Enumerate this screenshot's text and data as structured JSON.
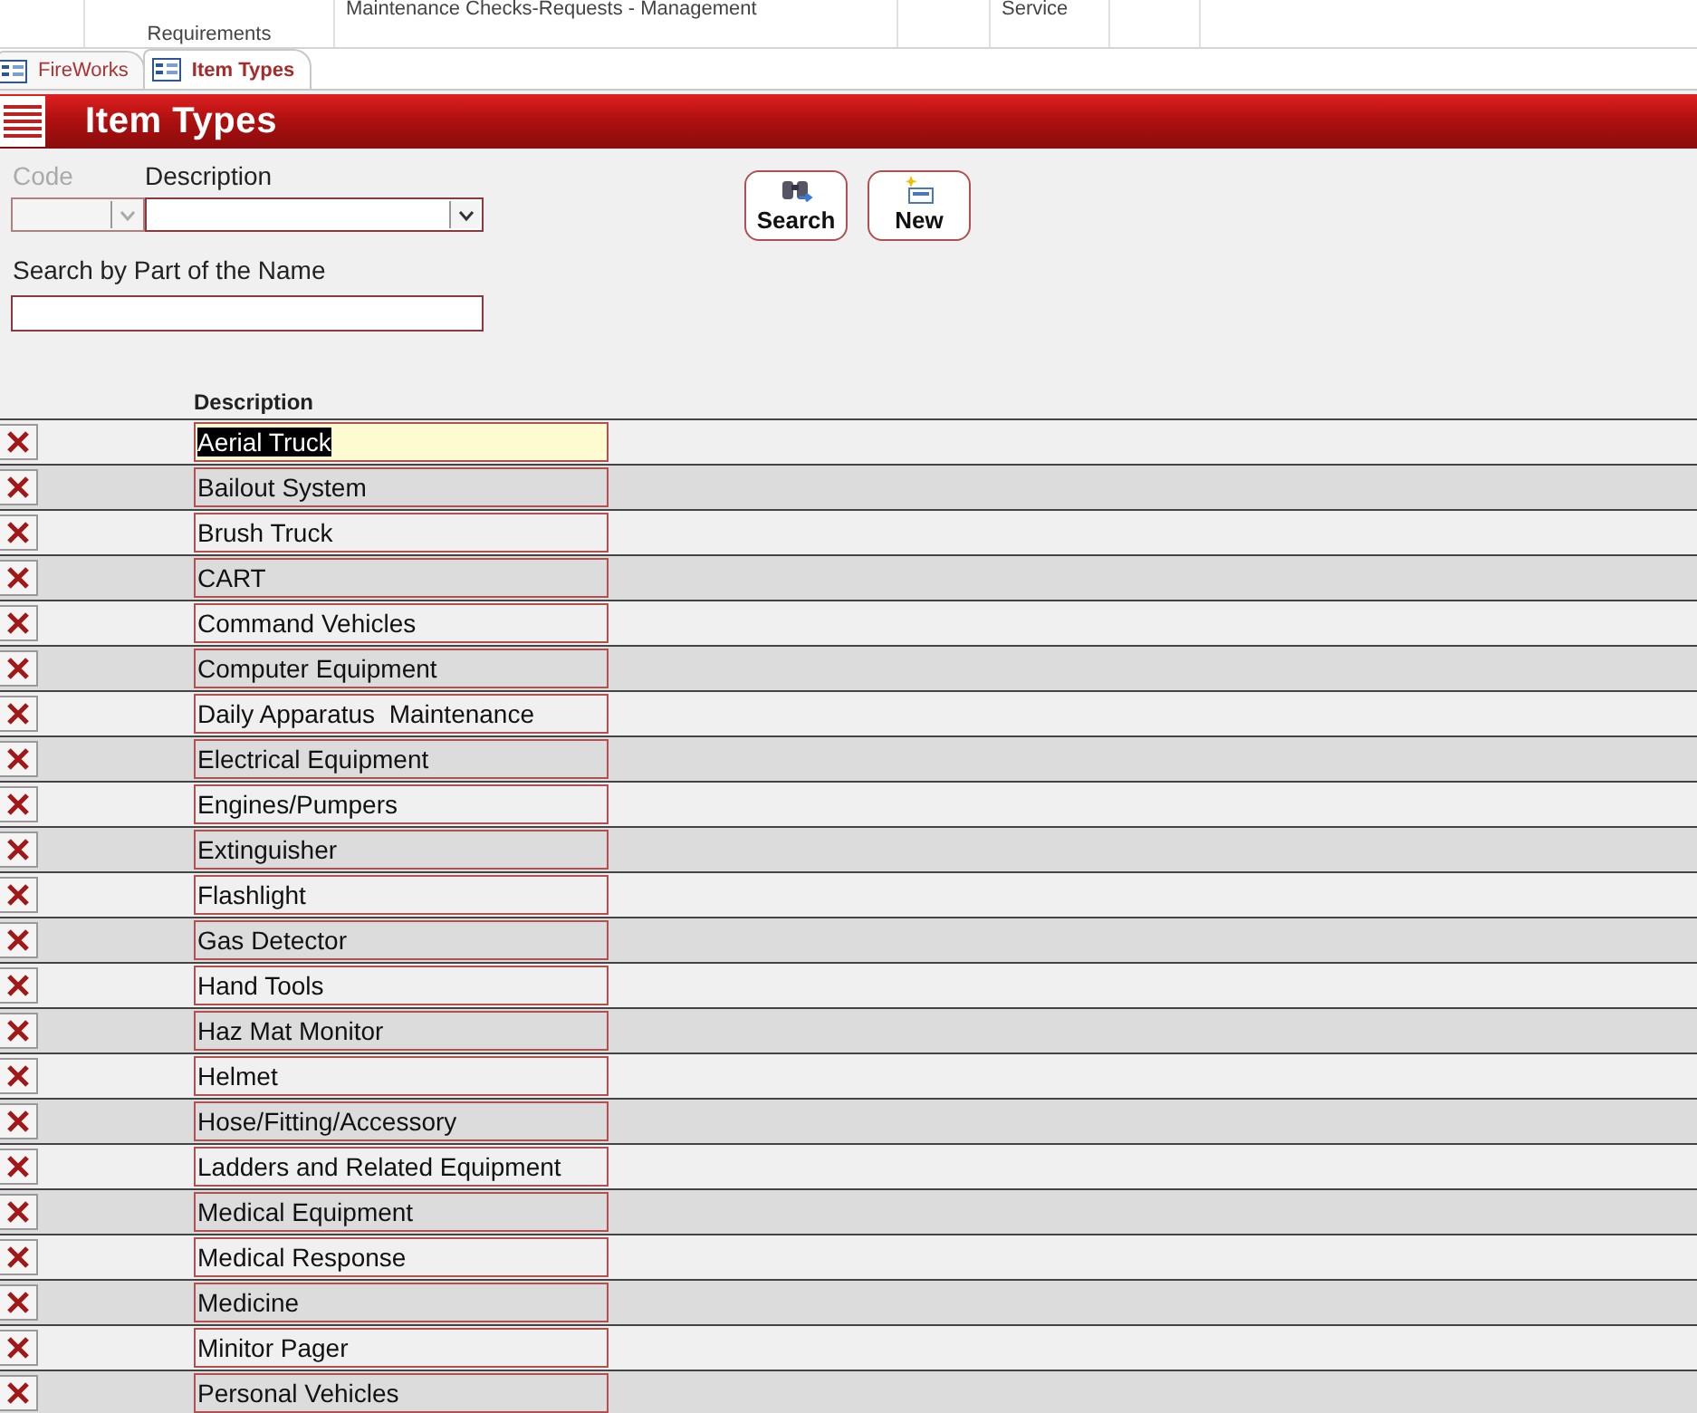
{
  "ribbon": {
    "items": [
      {
        "label": "Requirements",
        "kind": "caption"
      },
      {
        "label": "Maintenance Checks-Requests - Management",
        "kind": "command"
      },
      {
        "label": "Service",
        "kind": "command"
      }
    ]
  },
  "tabs": [
    {
      "label": "FireWorks",
      "selected": false
    },
    {
      "label": "Item Types",
      "selected": true
    }
  ],
  "header": {
    "title": "Item Types"
  },
  "filters": {
    "code": {
      "label": "Code",
      "disabled": true
    },
    "description": {
      "label": "Description"
    },
    "search_name": {
      "label": "Search by Part of the Name"
    }
  },
  "buttons": [
    {
      "label": "Search",
      "kind": "search"
    },
    {
      "label": "New",
      "kind": "new"
    }
  ],
  "list": {
    "column_header": "Description",
    "rows": [
      {
        "description": "Aerial Truck",
        "selected": true
      },
      {
        "description": "Bailout System",
        "selected": false
      },
      {
        "description": "Brush Truck",
        "selected": false
      },
      {
        "description": "CART",
        "selected": false
      },
      {
        "description": "Command Vehicles",
        "selected": false
      },
      {
        "description": "Computer Equipment",
        "selected": false
      },
      {
        "description": "Daily Apparatus  Maintenance",
        "selected": false
      },
      {
        "description": "Electrical Equipment",
        "selected": false
      },
      {
        "description": "Engines/Pumpers",
        "selected": false
      },
      {
        "description": "Extinguisher",
        "selected": false
      },
      {
        "description": "Flashlight",
        "selected": false
      },
      {
        "description": "Gas Detector",
        "selected": false
      },
      {
        "description": "Hand Tools",
        "selected": false
      },
      {
        "description": "Haz Mat Monitor",
        "selected": false
      },
      {
        "description": "Helmet",
        "selected": false
      },
      {
        "description": "Hose/Fitting/Accessory",
        "selected": false
      },
      {
        "description": "Ladders and Related Equipment",
        "selected": false
      },
      {
        "description": "Medical Equipment",
        "selected": false
      },
      {
        "description": "Medical Response",
        "selected": false
      },
      {
        "description": "Medicine",
        "selected": false
      },
      {
        "description": "Minitor Pager",
        "selected": false
      },
      {
        "description": "Personal Vehicles",
        "selected": false
      }
    ]
  }
}
